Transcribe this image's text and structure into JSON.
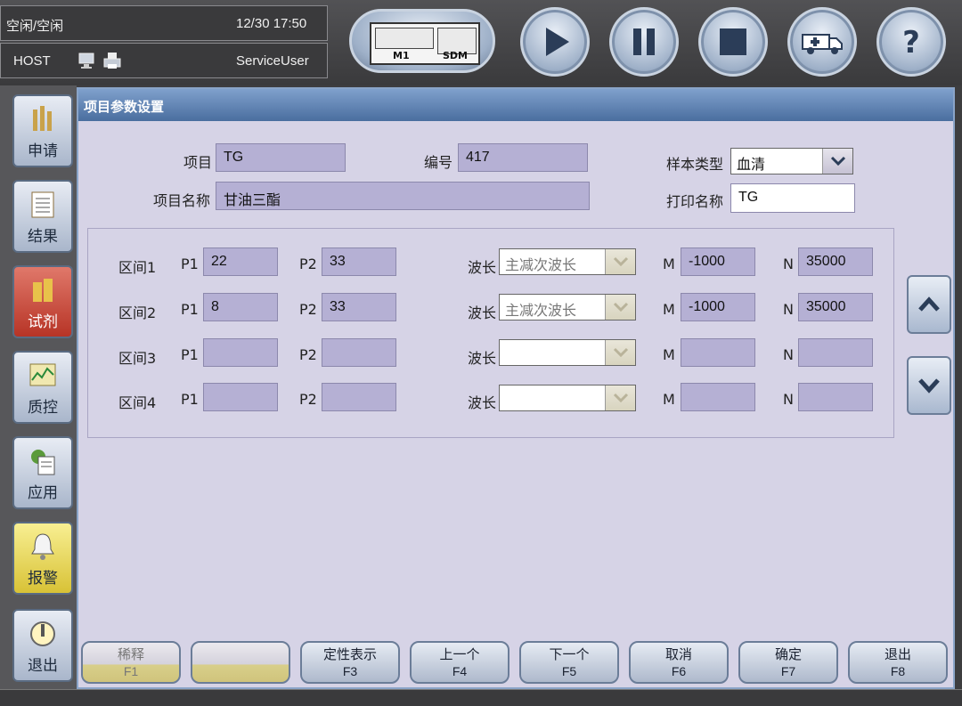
{
  "status": {
    "state": "空闲/空闲",
    "datetime": "12/30 17:50",
    "host": "HOST",
    "user": "ServiceUser"
  },
  "toolbar": {
    "module_m1": "M1",
    "module_sdm": "SDM"
  },
  "nav": {
    "items": [
      {
        "label": "申请",
        "icon": "request-icon"
      },
      {
        "label": "结果",
        "icon": "results-icon"
      },
      {
        "label": "试剂",
        "icon": "reagent-icon"
      },
      {
        "label": "质控",
        "icon": "qc-chart-icon"
      },
      {
        "label": "应用",
        "icon": "application-icon"
      },
      {
        "label": "报警",
        "icon": "bell-icon"
      },
      {
        "label": "退出",
        "icon": "power-icon"
      }
    ]
  },
  "panel": {
    "title": "项目参数设置",
    "item_label": "项目",
    "item_value": "TG",
    "number_label": "编号",
    "number_value": "417",
    "sample_type_label": "样本类型",
    "sample_type_value": "血清",
    "item_name_label": "项目名称",
    "item_name_value": "甘油三酯",
    "print_name_label": "打印名称",
    "print_name_value": "TG"
  },
  "ranges": {
    "p1_label": "P1",
    "p2_label": "P2",
    "wavelength_label": "波长",
    "m_label": "M",
    "n_label": "N",
    "rows": [
      {
        "name": "区间1",
        "p1": "22",
        "p2": "33",
        "wavelength": "主减次波长",
        "m": "-1000",
        "n": "35000"
      },
      {
        "name": "区间2",
        "p1": "8",
        "p2": "33",
        "wavelength": "主减次波长",
        "m": "-1000",
        "n": "35000"
      },
      {
        "name": "区间3",
        "p1": "",
        "p2": "",
        "wavelength": "",
        "m": "",
        "n": ""
      },
      {
        "name": "区间4",
        "p1": "",
        "p2": "",
        "wavelength": "",
        "m": "",
        "n": ""
      }
    ]
  },
  "fkeys": [
    {
      "label": "稀释",
      "key": "F1",
      "enabled": false
    },
    {
      "label": "",
      "key": "",
      "enabled": false
    },
    {
      "label": "定性表示",
      "key": "F3",
      "enabled": true
    },
    {
      "label": "上一个",
      "key": "F4",
      "enabled": true
    },
    {
      "label": "下一个",
      "key": "F5",
      "enabled": true
    },
    {
      "label": "取消",
      "key": "F6",
      "enabled": true
    },
    {
      "label": "确定",
      "key": "F7",
      "enabled": true
    },
    {
      "label": "退出",
      "key": "F8",
      "enabled": true
    }
  ]
}
